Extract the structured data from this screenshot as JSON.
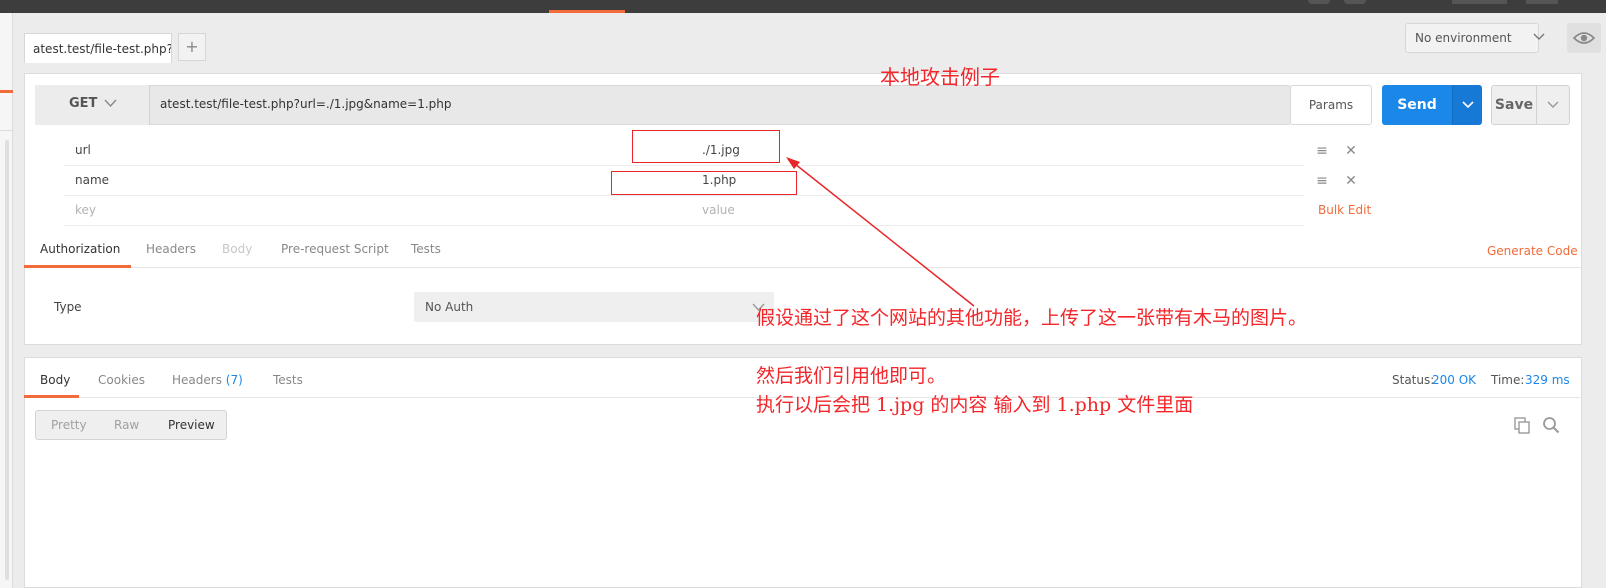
{
  "tab": {
    "label": "atest.test/file-test.php?u",
    "add_label": "+"
  },
  "environment": {
    "selected": "No environment"
  },
  "request": {
    "method": "GET",
    "url": "atest.test/file-test.php?url=./1.jpg&name=1.php",
    "params_label": "Params",
    "send_label": "Send",
    "save_label": "Save"
  },
  "params": {
    "rows": [
      {
        "key": "url",
        "value": "./1.jpg"
      },
      {
        "key": "name",
        "value": "1.php"
      }
    ],
    "key_placeholder": "key",
    "value_placeholder": "value",
    "bulk_edit_label": "Bulk Edit"
  },
  "request_tabs": [
    "Authorization",
    "Headers",
    "Body",
    "Pre-request Script",
    "Tests"
  ],
  "generate_code_label": "Generate Code",
  "auth": {
    "type_label": "Type",
    "selected": "No Auth"
  },
  "response": {
    "tabs": {
      "body": "Body",
      "cookies": "Cookies",
      "headers": "Headers",
      "headers_count": "(7)",
      "tests": "Tests"
    },
    "status_label": "Status:",
    "status_value": "200 OK",
    "time_label": "Time:",
    "time_value": "329 ms",
    "view_modes": [
      "Pretty",
      "Raw",
      "Preview"
    ]
  },
  "annotations": {
    "title": "本地攻击例子",
    "line1": "假设通过了这个网站的其他功能，上传了这一张带有木马的图片。",
    "line2": "然后我们引用他即可。",
    "line3": "执行以后会把 1.jpg 的内容 输入到 1.php 文件里面"
  },
  "colors": {
    "accent": "#f26b3a",
    "send": "#1a87e9",
    "annotation": "#f3262a"
  },
  "icons": [
    "chevron-down-icon",
    "eye-icon",
    "menu-icon",
    "close-icon",
    "copy-icon",
    "search-icon"
  ]
}
